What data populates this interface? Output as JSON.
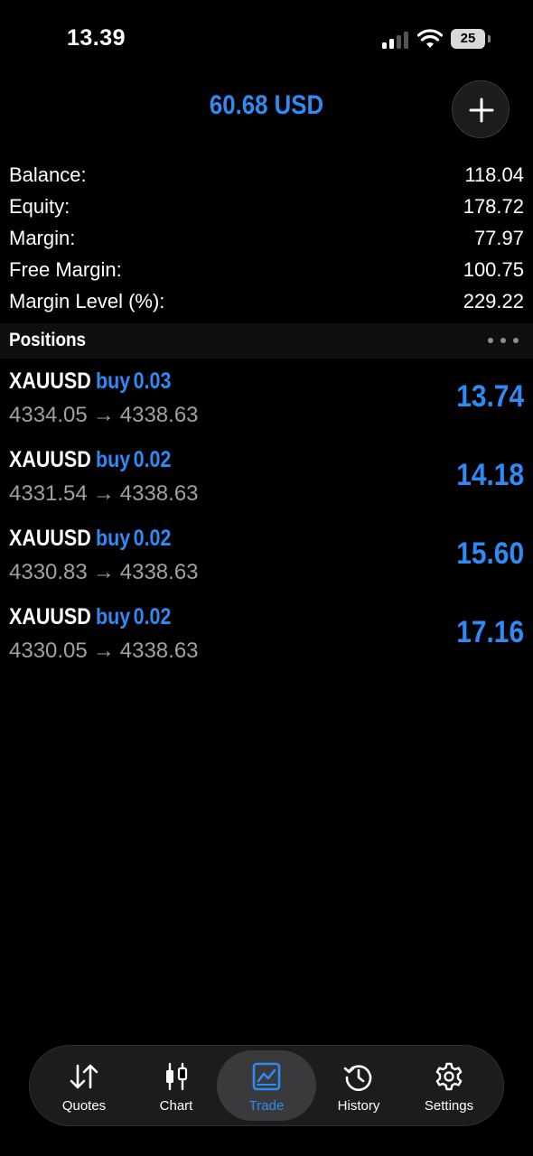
{
  "status_bar": {
    "time": "13.39",
    "battery": "25"
  },
  "header": {
    "total": "60.68 USD",
    "add_icon": "plus-icon"
  },
  "summary": {
    "balance_label": "Balance:",
    "balance_value": "118.04",
    "equity_label": "Equity:",
    "equity_value": "178.72",
    "margin_label": "Margin:",
    "margin_value": "77.97",
    "free_margin_label": "Free Margin:",
    "free_margin_value": "100.75",
    "margin_level_label": "Margin Level (%):",
    "margin_level_value": "229.22"
  },
  "positions": {
    "title": "Positions",
    "items": [
      {
        "symbol": "XAUUSD",
        "side": "buy",
        "volume": "0.03",
        "open_price": "4334.05",
        "current_price": "4338.63",
        "profit": "13.74"
      },
      {
        "symbol": "XAUUSD",
        "side": "buy",
        "volume": "0.02",
        "open_price": "4331.54",
        "current_price": "4338.63",
        "profit": "14.18"
      },
      {
        "symbol": "XAUUSD",
        "side": "buy",
        "volume": "0.02",
        "open_price": "4330.83",
        "current_price": "4338.63",
        "profit": "15.60"
      },
      {
        "symbol": "XAUUSD",
        "side": "buy",
        "volume": "0.02",
        "open_price": "4330.05",
        "current_price": "4338.63",
        "profit": "17.16"
      }
    ]
  },
  "tabs": [
    {
      "label": "Quotes",
      "icon": "quotes-arrows-icon"
    },
    {
      "label": "Chart",
      "icon": "candlestick-icon"
    },
    {
      "label": "Trade",
      "icon": "trade-chart-icon",
      "active": true
    },
    {
      "label": "History",
      "icon": "history-clock-icon"
    },
    {
      "label": "Settings",
      "icon": "gear-icon"
    }
  ],
  "colors": {
    "accent": "#2f8af5",
    "background": "#000000",
    "muted_text": "#a0a0a0"
  }
}
